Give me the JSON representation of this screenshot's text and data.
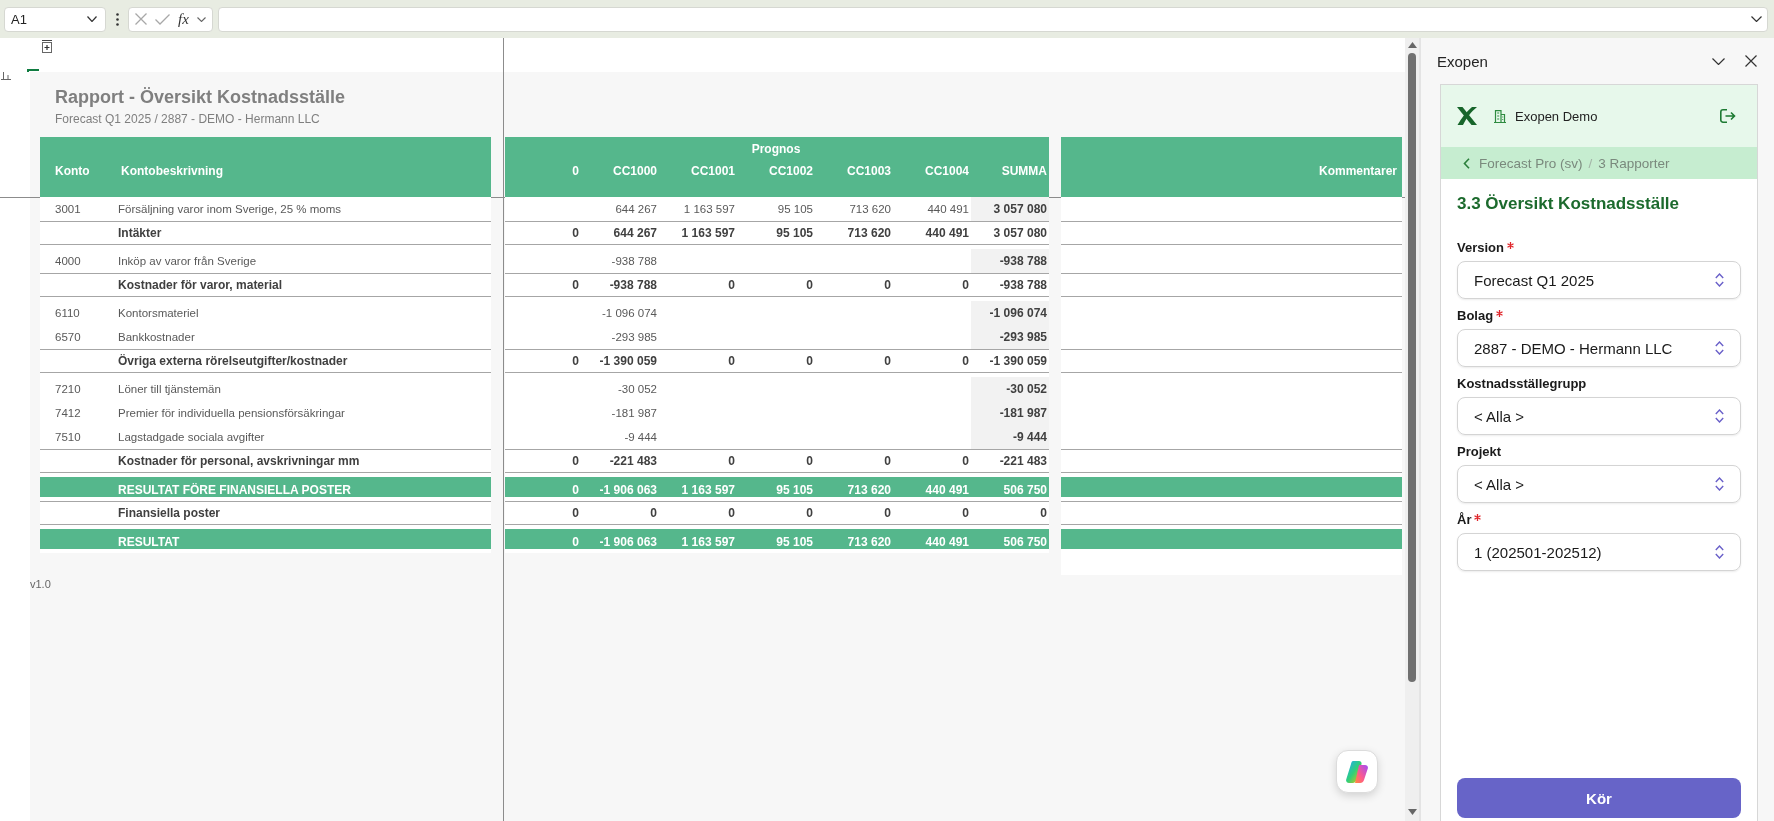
{
  "formula_bar": {
    "name_box": "A1",
    "function_label": "fx"
  },
  "sheet": {
    "report_title": "Rapport - Översikt Kostnadsställe",
    "report_subtitle": "Forecast Q1 2025 / 2887 - DEMO - Hermann LLC",
    "table": {
      "group_header": "Prognos",
      "columns": [
        "Konto",
        "Kontobeskrivning",
        "0",
        "CC1000",
        "CC1001",
        "CC1002",
        "CC1003",
        "CC1004",
        "SUMMA",
        "Kommentarer"
      ],
      "rows": [
        {
          "kind": "detail",
          "account": "3001",
          "description": "Försäljning varor inom Sverige, 25 % moms",
          "values": {
            "cc1000": "644 267",
            "cc1001": "1 163 597",
            "cc1002": "95 105",
            "cc1003": "713 620",
            "cc1004": "440 491",
            "summa": "3 057 080"
          }
        },
        {
          "kind": "subtotal",
          "description": "Intäkter",
          "values": {
            "col_0": "0",
            "cc1000": "644 267",
            "cc1001": "1 163 597",
            "cc1002": "95 105",
            "cc1003": "713 620",
            "cc1004": "440 491",
            "summa": "3 057 080"
          }
        },
        {
          "kind": "detail",
          "account": "4000",
          "description": "Inköp av varor från Sverige",
          "values": {
            "cc1000": "-938 788",
            "summa": "-938 788"
          }
        },
        {
          "kind": "subtotal",
          "description": "Kostnader för varor, material",
          "values": {
            "col_0": "0",
            "cc1000": "-938 788",
            "cc1001": "0",
            "cc1002": "0",
            "cc1003": "0",
            "cc1004": "0",
            "summa": "-938 788"
          }
        },
        {
          "kind": "detail",
          "account": "6110",
          "description": "Kontorsmateriel",
          "values": {
            "cc1000": "-1 096 074",
            "summa": "-1 096 074"
          }
        },
        {
          "kind": "detail",
          "account": "6570",
          "description": "Bankkostnader",
          "values": {
            "cc1000": "-293 985",
            "summa": "-293 985"
          }
        },
        {
          "kind": "subtotal",
          "description": "Övriga externa rörelseutgifter/kostnader",
          "values": {
            "col_0": "0",
            "cc1000": "-1 390 059",
            "cc1001": "0",
            "cc1002": "0",
            "cc1003": "0",
            "cc1004": "0",
            "summa": "-1 390 059"
          }
        },
        {
          "kind": "detail",
          "account": "7210",
          "description": "Löner till tjänstemän",
          "values": {
            "cc1000": "-30 052",
            "summa": "-30 052"
          }
        },
        {
          "kind": "detail",
          "account": "7412",
          "description": "Premier för individuella pensionsförsäkringar",
          "values": {
            "cc1000": "-181 987",
            "summa": "-181 987"
          }
        },
        {
          "kind": "detail",
          "account": "7510",
          "description": "Lagstadgade sociala avgifter",
          "values": {
            "cc1000": "-9 444",
            "summa": "-9 444"
          }
        },
        {
          "kind": "subtotal",
          "description": "Kostnader för personal, avskrivningar mm",
          "values": {
            "col_0": "0",
            "cc1000": "-221 483",
            "cc1001": "0",
            "cc1002": "0",
            "cc1003": "0",
            "cc1004": "0",
            "summa": "-221 483"
          }
        },
        {
          "kind": "result",
          "description": "RESULTAT FÖRE FINANSIELLA POSTER",
          "values": {
            "col_0": "0",
            "cc1000": "-1 906 063",
            "cc1001": "1 163 597",
            "cc1002": "95 105",
            "cc1003": "713 620",
            "cc1004": "440 491",
            "summa": "506 750"
          }
        },
        {
          "kind": "subtotal",
          "description": "Finansiella poster",
          "values": {
            "col_0": "0",
            "cc1000": "0",
            "cc1001": "0",
            "cc1002": "0",
            "cc1003": "0",
            "cc1004": "0",
            "summa": "0"
          }
        },
        {
          "kind": "result",
          "description": "RESULTAT",
          "values": {
            "col_0": "0",
            "cc1000": "-1 906 063",
            "cc1001": "1 163 597",
            "cc1002": "95 105",
            "cc1003": "713 620",
            "cc1004": "440 491",
            "summa": "506 750"
          }
        }
      ]
    },
    "version_label": "v1.0"
  },
  "task_pane": {
    "title": "Exopen",
    "workspace": "Exopen Demo",
    "breadcrumb": [
      "Forecast Pro (sv)",
      "3 Rapporter"
    ],
    "breadcrumb_separator": "/",
    "report_title": "3.3 Översikt Kostnadsställe",
    "fields": [
      {
        "label": "Version",
        "required": true,
        "value": "Forecast Q1 2025"
      },
      {
        "label": "Bolag",
        "required": true,
        "value": "2887 - DEMO - Hermann LLC"
      },
      {
        "label": "Kostnadsställegrupp",
        "required": false,
        "value": "< Alla >"
      },
      {
        "label": "Projekt",
        "required": false,
        "value": "< Alla >"
      },
      {
        "label": "År",
        "required": true,
        "value": "1 (202501-202512)"
      }
    ],
    "run_button": "Kör"
  }
}
